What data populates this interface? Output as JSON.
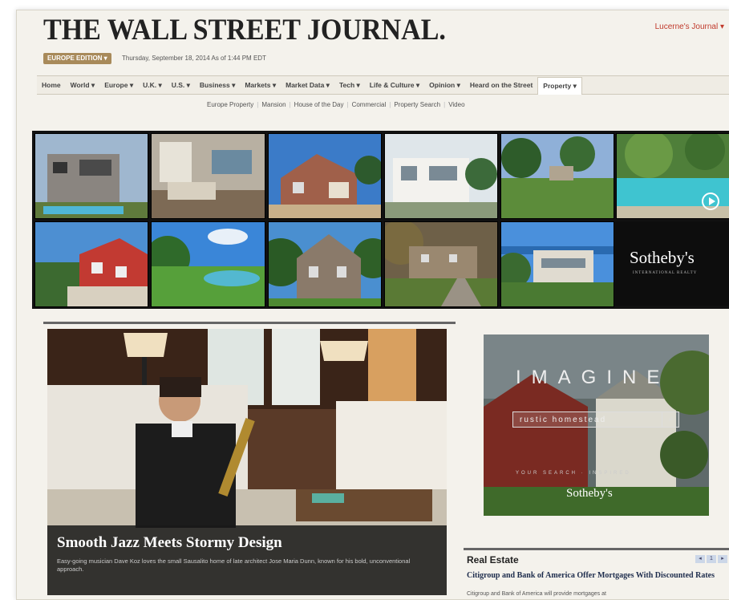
{
  "header": {
    "masthead": "THE WALL STREET JOURNAL.",
    "user_link": "Lucerne's Journal ▾",
    "edition_label": "EUROPE EDITION ▾",
    "dateline": "Thursday, September 18, 2014 As of 1:44 PM EDT"
  },
  "nav": {
    "items": [
      "Home",
      "World ▾",
      "Europe ▾",
      "U.K. ▾",
      "U.S. ▾",
      "Business ▾",
      "Markets ▾",
      "Market Data ▾",
      "Tech ▾",
      "Life & Culture ▾",
      "Opinion ▾",
      "Heard on the Street",
      "Property ▾"
    ],
    "active": "Property ▾"
  },
  "subnav": {
    "items": [
      "Europe Property",
      "Mansion",
      "House of the Day",
      "Commercial",
      "Property Search",
      "Video"
    ]
  },
  "gallery": {
    "brand": "Sotheby's",
    "brand_sub": "INTERNATIONAL REALTY"
  },
  "hero": {
    "title": "Smooth Jazz Meets Stormy Design",
    "description": "Easy-going musician Dave Koz loves the small Sausalito home of late architect Jose Maria Dunn, known for his bold, unconventional approach."
  },
  "ad": {
    "headline": "IMAGINE",
    "search_value": "rustic homestead",
    "tagline": "YOUR SEARCH · INSPIRED",
    "logo": "Sotheby's"
  },
  "real_estate": {
    "label": "Real Estate",
    "pager": [
      "◂",
      "1",
      "▸"
    ],
    "headline": "Citigroup and Bank of America Offer Mortgages With Discounted Rates",
    "dek": "Citigroup and Bank of America will provide mortgages at"
  },
  "colors": {
    "page_bg": "#f4f2ec",
    "accent_red": "#c0392b",
    "edition_tan": "#a88a5a",
    "headline_blue": "#1d2c4c"
  }
}
